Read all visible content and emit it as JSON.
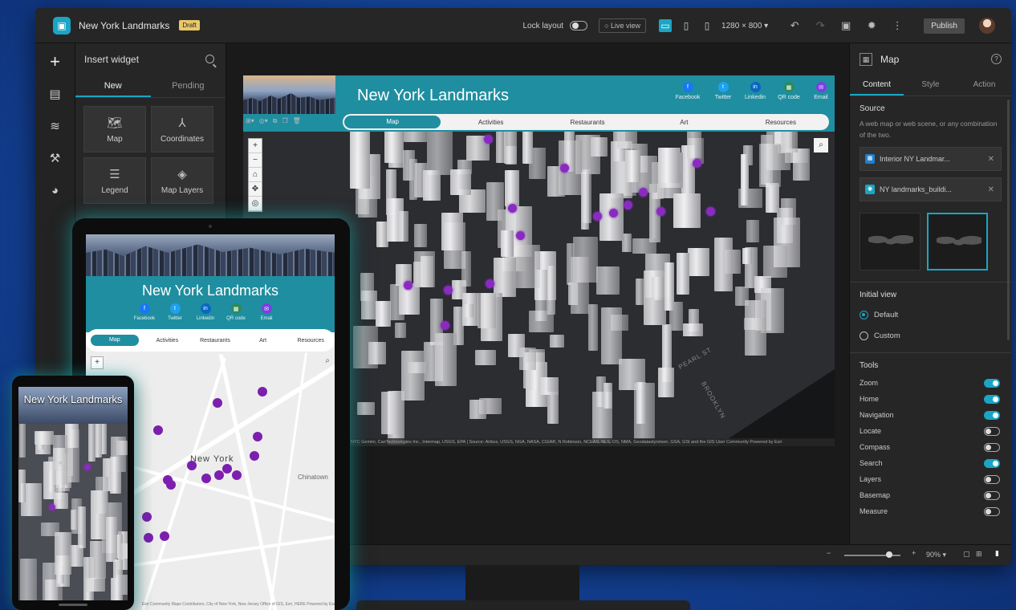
{
  "topbar": {
    "app_title": "New York Landmarks",
    "draft_badge": "Draft",
    "lock_layout_label": "Lock layout",
    "live_view_label": "Live view",
    "resolution": "1280 × 800",
    "publish_label": "Publish"
  },
  "left_rail": {
    "items": [
      "plus-icon",
      "page-icon",
      "data-icon",
      "wrench-icon",
      "palette-icon"
    ]
  },
  "widget_panel": {
    "title": "Insert widget",
    "tabs": [
      {
        "label": "New",
        "active": true
      },
      {
        "label": "Pending",
        "active": false
      }
    ],
    "tiles": [
      {
        "label": "Map",
        "icon": "map-icon"
      },
      {
        "label": "Coordinates",
        "icon": "coordinates-icon"
      },
      {
        "label": "Legend",
        "icon": "legend-icon"
      },
      {
        "label": "Map Layers",
        "icon": "layers-icon"
      }
    ]
  },
  "app": {
    "title": "New York Landmarks",
    "social": [
      {
        "label": "Facebook",
        "glyph": "f",
        "color": "#1877f2"
      },
      {
        "label": "Twitter",
        "glyph": "t",
        "color": "#1da1f2"
      },
      {
        "label": "Linkedin",
        "glyph": "in",
        "color": "#0a66c2"
      },
      {
        "label": "QR code",
        "glyph": "▦",
        "color": "#2e8b57"
      },
      {
        "label": "Email",
        "glyph": "✉",
        "color": "#7b3fe4"
      }
    ],
    "nav": [
      {
        "label": "Map",
        "active": true
      },
      {
        "label": "Activities",
        "active": false
      },
      {
        "label": "Restaurants",
        "active": false
      },
      {
        "label": "Art",
        "active": false
      },
      {
        "label": "Resources",
        "active": false
      }
    ],
    "map_labels": [
      "PEARL ST",
      "BROOKLYN"
    ],
    "attribution": "NYC Gemini, CanTechnologies Inc., Intermap, USGS, EPA | Source: Airbus, USGS, NGA, NASA, CGIAR, N Robinson, NCEAS, NLS, OS, NMA, Geodatastyrelsen, GSA, GSI and the GIS User Community     Powered by Esri"
  },
  "bottombar": {
    "zoom_percent": "90%"
  },
  "props": {
    "title": "Map",
    "tabs": [
      {
        "label": "Content",
        "active": true
      },
      {
        "label": "Style",
        "active": false
      },
      {
        "label": "Action",
        "active": false
      }
    ],
    "source_title": "Source",
    "source_desc": "A web map or web scene, or any combination of the two.",
    "sources": [
      "Interior NY Landmar...",
      "NY landmarks_buildi..."
    ],
    "initial_view_title": "Initial view",
    "initial_view_options": [
      {
        "label": "Default",
        "selected": true
      },
      {
        "label": "Custom",
        "selected": false
      }
    ],
    "tools_title": "Tools",
    "tools": [
      {
        "label": "Zoom",
        "on": true
      },
      {
        "label": "Home",
        "on": true
      },
      {
        "label": "Navigation",
        "on": true
      },
      {
        "label": "Locate",
        "on": false
      },
      {
        "label": "Compass",
        "on": false
      },
      {
        "label": "Search",
        "on": true
      },
      {
        "label": "Layers",
        "on": false
      },
      {
        "label": "Basemap",
        "on": false
      },
      {
        "label": "Measure",
        "on": false
      }
    ]
  },
  "tablet": {
    "title": "New York Landmarks",
    "nav": [
      "Map",
      "Activities",
      "Restaurants",
      "Art",
      "Resources"
    ],
    "map_label": "New York",
    "chinatown_label": "Chinatown",
    "attribution": "Esri Community Maps Contributors, City of New York, New Jersey Office of GIS, Esri, HERE     Powered by Esri"
  },
  "phone": {
    "title": "New York Landmarks"
  }
}
